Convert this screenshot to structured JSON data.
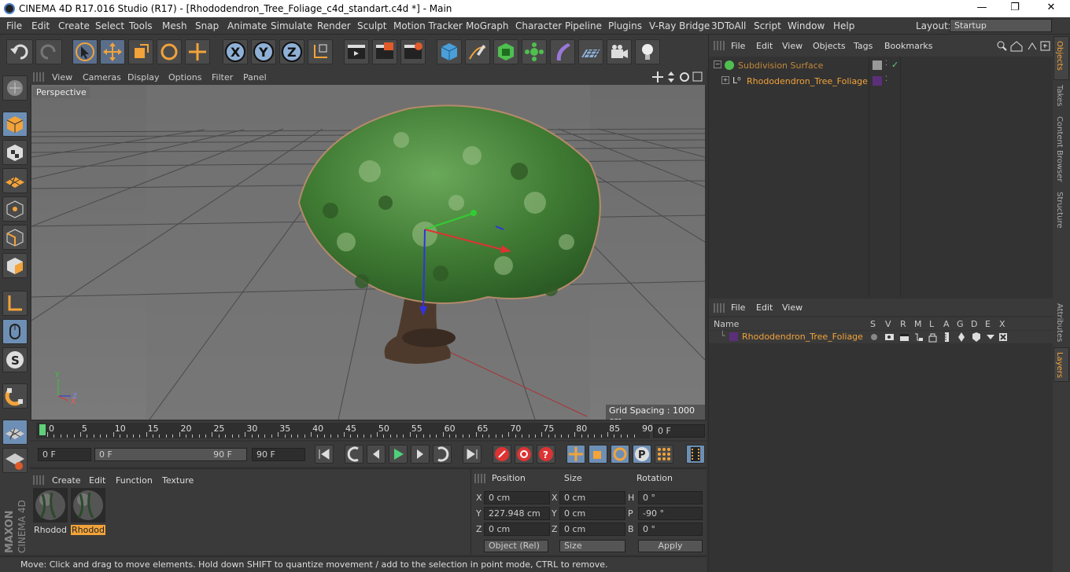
{
  "window": {
    "title": "CINEMA 4D R17.016 Studio (R17) - [Rhododendron_Tree_Foliage_c4d_standart.c4d *] - Main",
    "minimize": "—",
    "maximize": "❐",
    "close": "✕"
  },
  "menu": [
    "File",
    "Edit",
    "Create",
    "Select",
    "Tools",
    "Mesh",
    "Snap",
    "Animate",
    "Simulate",
    "Render",
    "Sculpt",
    "Motion Tracker",
    "MoGraph",
    "Character",
    "Pipeline",
    "Plugins",
    "V-Ray Bridge",
    "3DToAll",
    "Script",
    "Window",
    "Help"
  ],
  "layout": {
    "label": "Layout:",
    "value": "Startup"
  },
  "viewport": {
    "menu": [
      "View",
      "Cameras",
      "Display",
      "Options",
      "Filter",
      "Panel"
    ],
    "label": "Perspective",
    "grid_spacing": "Grid Spacing : 1000 cm",
    "axis_x": "X",
    "axis_y": "Y",
    "axis_z": "Z"
  },
  "timeline": {
    "ticks": [
      "0",
      "5",
      "10",
      "15",
      "20",
      "25",
      "30",
      "35",
      "40",
      "45",
      "50",
      "55",
      "60",
      "65",
      "70",
      "75",
      "80",
      "85",
      "90"
    ],
    "current_frame": "0 F",
    "start": "0 F",
    "range_start": "0 F",
    "range_end": "90 F",
    "end": "90 F"
  },
  "materials": {
    "menu": [
      "Create",
      "Edit",
      "Function",
      "Texture"
    ],
    "items": [
      {
        "label": "Rhodod"
      },
      {
        "label": "Rhodod"
      }
    ]
  },
  "coords": {
    "headers": {
      "position": "Position",
      "size": "Size",
      "rotation": "Rotation"
    },
    "rows": [
      {
        "axis": "X",
        "pos": "0 cm",
        "size_axis": "X",
        "size": "0 cm",
        "rot_axis": "H",
        "rot": "0 °"
      },
      {
        "axis": "Y",
        "pos": "227.948 cm",
        "size_axis": "Y",
        "size": "0 cm",
        "rot_axis": "P",
        "rot": "-90 °"
      },
      {
        "axis": "Z",
        "pos": "0 cm",
        "size_axis": "Z",
        "size": "0 cm",
        "rot_axis": "B",
        "rot": "0 °"
      }
    ],
    "mode": "Object (Rel)",
    "size_mode": "Size",
    "apply": "Apply"
  },
  "status": "Move: Click and drag to move elements. Hold down SHIFT to quantize movement / add to the selection in point mode, CTRL to remove.",
  "objects": {
    "menu": [
      "File",
      "Edit",
      "View",
      "Objects",
      "Tags",
      "Bookmarks"
    ],
    "items": [
      {
        "name": "Subdivision Surface"
      },
      {
        "name": "Rhododendron_Tree_Foliage"
      }
    ]
  },
  "layers": {
    "menu": [
      "File",
      "Edit",
      "View"
    ],
    "columns": {
      "name": "Name",
      "flags": [
        "S",
        "V",
        "R",
        "M",
        "L",
        "A",
        "G",
        "D",
        "E",
        "X"
      ]
    },
    "items": [
      {
        "name": "Rhododendron_Tree_Foliage"
      }
    ]
  },
  "right_tabs": [
    "Objects",
    "Takes",
    "Content Browser",
    "Structure",
    "Attributes",
    "Layers"
  ],
  "brand": [
    "MAXON",
    "CINEMA 4D"
  ],
  "colors": {
    "accent": "#f2a33a",
    "selected_blue": "#6e8fb5",
    "layer_purple": "#5c2f7a"
  }
}
